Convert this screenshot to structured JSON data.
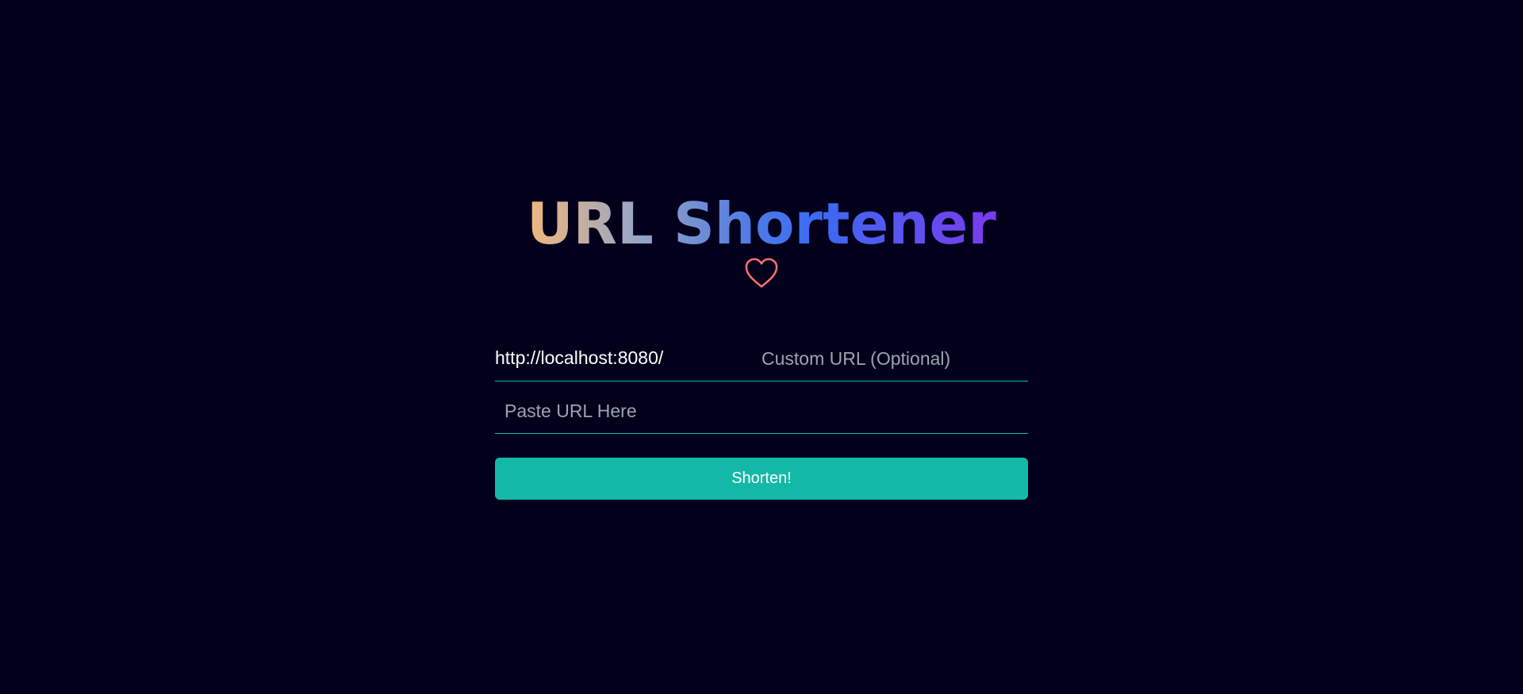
{
  "header": {
    "title": "URL Shortener",
    "icon": "heart-icon",
    "icon_color": "#f87171"
  },
  "form": {
    "base_url": "http://localhost:8080/",
    "custom_url": {
      "value": "",
      "placeholder": "Custom URL (Optional)"
    },
    "long_url": {
      "value": "",
      "placeholder": "Paste URL Here"
    },
    "submit_label": "Shorten!"
  },
  "colors": {
    "background": "#03001c",
    "accent": "#14b8a6",
    "title_gradient": [
      "#f2b979",
      "#4d7be6",
      "#7c3aed"
    ]
  }
}
